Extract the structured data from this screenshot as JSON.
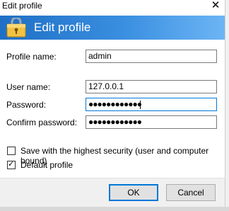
{
  "window": {
    "title": "Edit profile",
    "close_glyph": "✕"
  },
  "header": {
    "title": "Edit profile",
    "icon": "lock-icon",
    "accent_color": "#2b7fd6"
  },
  "form": {
    "profile_name": {
      "label": "Profile name:",
      "value": "admin"
    },
    "user_name": {
      "label": "User name:",
      "value": "127.0.0.1"
    },
    "password": {
      "label": "Password:",
      "value_masked": "●●●●●●●●●●●●"
    },
    "confirm_password": {
      "label": "Confirm password:",
      "value_masked": "●●●●●●●●●●●●"
    }
  },
  "options": {
    "highest_security": {
      "label": "Save with the highest security (user and computer bound)",
      "checked": false
    },
    "default_profile": {
      "label": "Default profile",
      "checked": true,
      "check_glyph": "✓"
    }
  },
  "buttons": {
    "ok": "OK",
    "cancel": "Cancel"
  }
}
